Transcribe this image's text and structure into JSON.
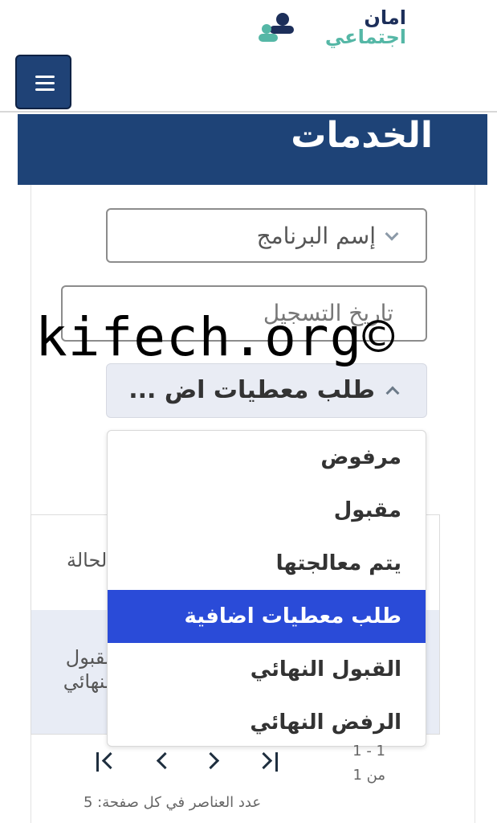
{
  "brand": {
    "logo_line1": "امان",
    "logo_line2": "اجتماعي",
    "colors": {
      "navy": "#1e4377",
      "teal": "#55b7a6",
      "selected": "#2a4bd8"
    }
  },
  "header": {
    "menu_icon": "hamburger-icon"
  },
  "page": {
    "title": "الخدمات"
  },
  "filters": {
    "program_name": "إسم البرنامج",
    "registration_date": "تاريخ التسجيل",
    "status_selected": "طلب معطيات اض ..."
  },
  "dropdown": {
    "options": [
      {
        "label": "مرفوض"
      },
      {
        "label": "مقبول"
      },
      {
        "label": "يتم معالجتها"
      },
      {
        "label": "طلب معطيات اضافية",
        "selected": true
      },
      {
        "label": "القبول النهائي"
      },
      {
        "label": "الرفض النهائي"
      }
    ]
  },
  "table": {
    "column_status": "الحالة",
    "row_status": "القبول النهائي"
  },
  "pagination": {
    "range": "1 - 1",
    "of_total": "من 1",
    "per_page": "عدد العناصر في كل صفحة: 5"
  },
  "watermark": "kifech.org©"
}
